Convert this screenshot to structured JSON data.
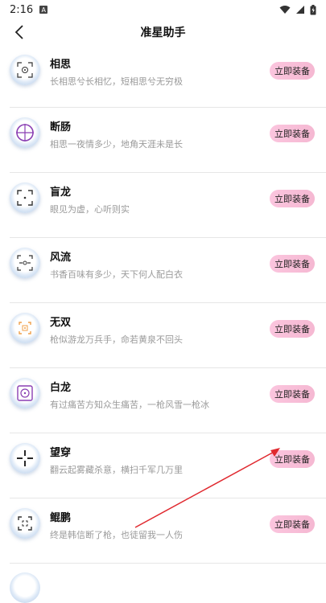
{
  "status_bar": {
    "time": "2:16",
    "notification_icon": "a-notification-icon",
    "icons": [
      "wifi-icon",
      "signal-icon",
      "battery-icon"
    ]
  },
  "header": {
    "title": "准星助手",
    "back_icon": "chevron-left-icon"
  },
  "colors": {
    "button_bg": "#f9c2dc",
    "arrow": "#e0292f"
  },
  "list": {
    "items": [
      {
        "name": "相思",
        "desc": "长相思兮长相忆，短相思兮无穷极",
        "button": "立即装备",
        "icon": "crosshair-dotted-icon"
      },
      {
        "name": "断肠",
        "desc": "相思一夜情多少，地角天涯未是长",
        "button": "立即装备",
        "icon": "crosshair-purple-circle-icon"
      },
      {
        "name": " 盲龙",
        "desc": "眼见为虚，心听则实",
        "button": "立即装备",
        "icon": "crosshair-corners-icon"
      },
      {
        "name": "风流",
        "desc": "书香百味有多少，天下何人配白衣",
        "button": "立即装备",
        "icon": "crosshair-bracket-icon"
      },
      {
        "name": "无双",
        "desc": "枪似游龙万兵手，命若黄泉不回头",
        "button": "立即装备",
        "icon": "crosshair-orange-icon"
      },
      {
        "name": "白龙",
        "desc": "有过痛苦方知众生痛苦，一枪风雪一枪冰",
        "button": "立即装备",
        "icon": "crosshair-square-purple-icon"
      },
      {
        "name": "望穿",
        "desc": "翻云起雾藏杀意，横扫千军几万里",
        "button": "立即装备",
        "icon": "crosshair-cross-icon"
      },
      {
        "name": "鲲鹏",
        "desc": "终是韩信断了枪，也徒留我一人伤",
        "button": "立即装备",
        "icon": "crosshair-frame-icon"
      }
    ]
  }
}
